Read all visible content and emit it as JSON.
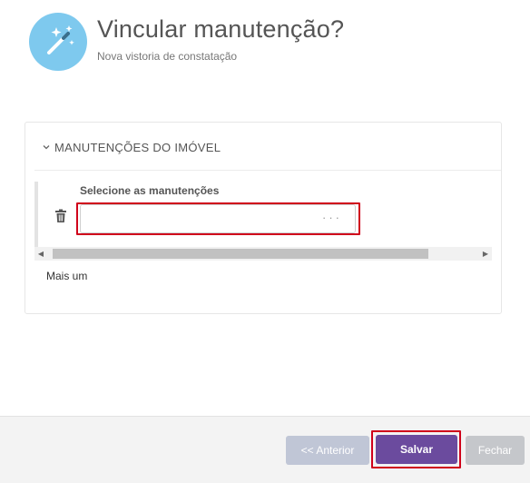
{
  "dialog": {
    "icon": "magic-wand-icon",
    "title": "Vincular manutenção?",
    "subtitle": "Nova vistoria de constatação"
  },
  "panel": {
    "header": "MANUTENÇÕES DO IMÓVEL",
    "header_icon": "chevron-down-icon",
    "row": {
      "delete_icon": "trash-icon",
      "field_label": "Selecione as manutenções",
      "field_value": "",
      "more_icon": "ellipsis-icon",
      "more_glyph": "···"
    },
    "add_more": "Mais um"
  },
  "footer": {
    "prev_label": "<< Anterior",
    "save_label": "Salvar",
    "close_label": "Fechar"
  },
  "colors": {
    "icon_bg": "#7ec9ee",
    "primary": "#6b4b9e",
    "disabled": "#c0c6d6",
    "highlight": "#d0021b"
  }
}
